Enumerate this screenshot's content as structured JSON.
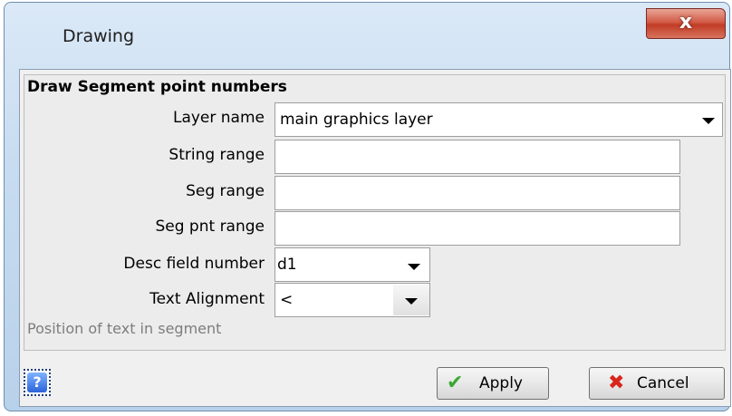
{
  "window": {
    "title": "Drawing",
    "close_glyph": "x"
  },
  "panel": {
    "title": "Draw Segment point numbers",
    "fields": {
      "layer_name": {
        "label": "Layer name",
        "value": "main graphics layer"
      },
      "string_range": {
        "label": "String range",
        "value": ""
      },
      "seg_range": {
        "label": "Seg range",
        "value": ""
      },
      "seg_pnt_range": {
        "label": "Seg pnt range",
        "value": ""
      },
      "desc_field_number": {
        "label": "Desc field number",
        "value": "d1"
      },
      "text_alignment": {
        "label": "Text Alignment",
        "value": "<"
      }
    },
    "hint": "Position of text in segment"
  },
  "buttons": {
    "help": "?",
    "apply": "Apply",
    "cancel": "Cancel"
  },
  "icons": {
    "apply": "checkmark-icon",
    "cancel": "red-x-icon",
    "help": "question-icon"
  },
  "colors": {
    "apply_check": "#3aa832",
    "cancel_x": "#d8261c",
    "close_button": "#c9452f"
  }
}
